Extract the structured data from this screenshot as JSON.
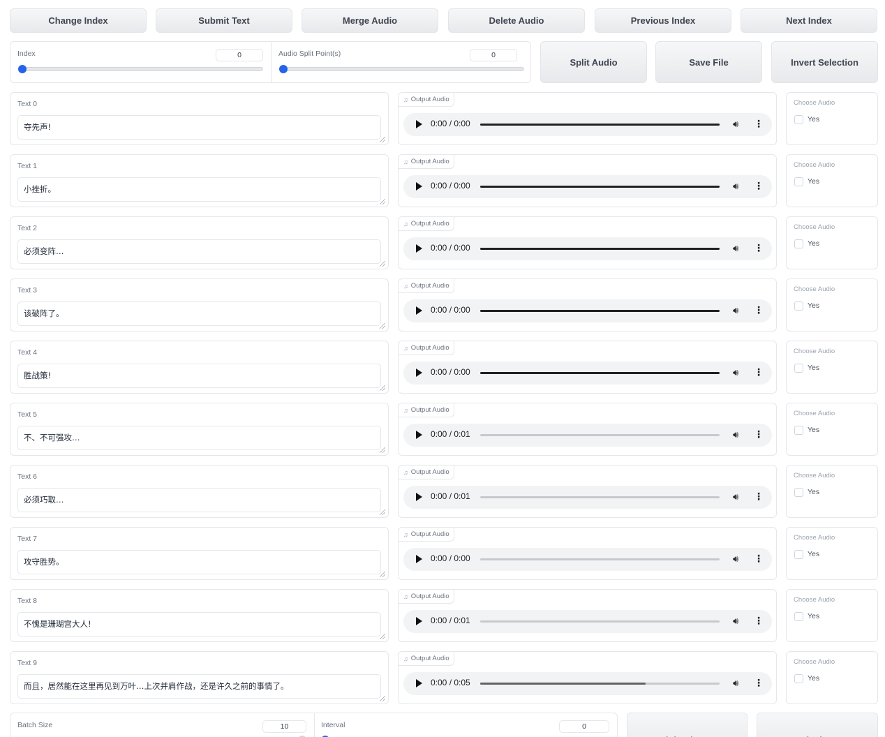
{
  "toolbar": {
    "buttons": [
      "Change Index",
      "Submit Text",
      "Merge Audio",
      "Delete Audio",
      "Previous Index",
      "Next Index"
    ]
  },
  "controls": {
    "index_label": "Index",
    "index_value": "0",
    "split_label": "Audio Split Point(s)",
    "split_value": "0",
    "split_button": "Split Audio",
    "save_button": "Save File",
    "invert_button": "Invert Selection"
  },
  "rows": [
    {
      "label": "Text 0",
      "text": "夺先声!",
      "audio_label": "Output Audio",
      "time": "0:00 / 0:00",
      "progress": 1.0,
      "choose_label": "Choose Audio",
      "yes": "Yes"
    },
    {
      "label": "Text 1",
      "text": "小挫折。",
      "audio_label": "Output Audio",
      "time": "0:00 / 0:00",
      "progress": 1.0,
      "choose_label": "Choose Audio",
      "yes": "Yes"
    },
    {
      "label": "Text 2",
      "text": "必须变阵…",
      "audio_label": "Output Audio",
      "time": "0:00 / 0:00",
      "progress": 1.0,
      "choose_label": "Choose Audio",
      "yes": "Yes"
    },
    {
      "label": "Text 3",
      "text": "该破阵了。",
      "audio_label": "Output Audio",
      "time": "0:00 / 0:00",
      "progress": 1.0,
      "choose_label": "Choose Audio",
      "yes": "Yes"
    },
    {
      "label": "Text 4",
      "text": "胜战策!",
      "audio_label": "Output Audio",
      "time": "0:00 / 0:00",
      "progress": 1.0,
      "choose_label": "Choose Audio",
      "yes": "Yes"
    },
    {
      "label": "Text 5",
      "text": "不、不可强攻…",
      "audio_label": "Output Audio",
      "time": "0:00 / 0:01",
      "progress": 0.0,
      "choose_label": "Choose Audio",
      "yes": "Yes"
    },
    {
      "label": "Text 6",
      "text": "必须巧取…",
      "audio_label": "Output Audio",
      "time": "0:00 / 0:01",
      "progress": 0.0,
      "choose_label": "Choose Audio",
      "yes": "Yes"
    },
    {
      "label": "Text 7",
      "text": "攻守胜势。",
      "audio_label": "Output Audio",
      "time": "0:00 / 0:00",
      "progress": 0.0,
      "choose_label": "Choose Audio",
      "yes": "Yes"
    },
    {
      "label": "Text 8",
      "text": "不愧是珊瑚宫大人!",
      "audio_label": "Output Audio",
      "time": "0:00 / 0:01",
      "progress": 0.0,
      "choose_label": "Choose Audio",
      "yes": "Yes"
    },
    {
      "label": "Text 9",
      "text": "而且，居然能在这里再见到万叶…上次并肩作战，还是许久之前的事情了。",
      "audio_label": "Output Audio",
      "time": "0:00 / 0:05",
      "progress": 0.0,
      "buffered": 0.69,
      "choose_label": "Choose Audio",
      "yes": "Yes"
    }
  ],
  "bottom": {
    "batch_label": "Batch Size",
    "batch_value": "10",
    "interval_label": "Interval",
    "interval_value": "0",
    "light_theme": "Light Theme",
    "dark_theme": "Dark Theme"
  }
}
